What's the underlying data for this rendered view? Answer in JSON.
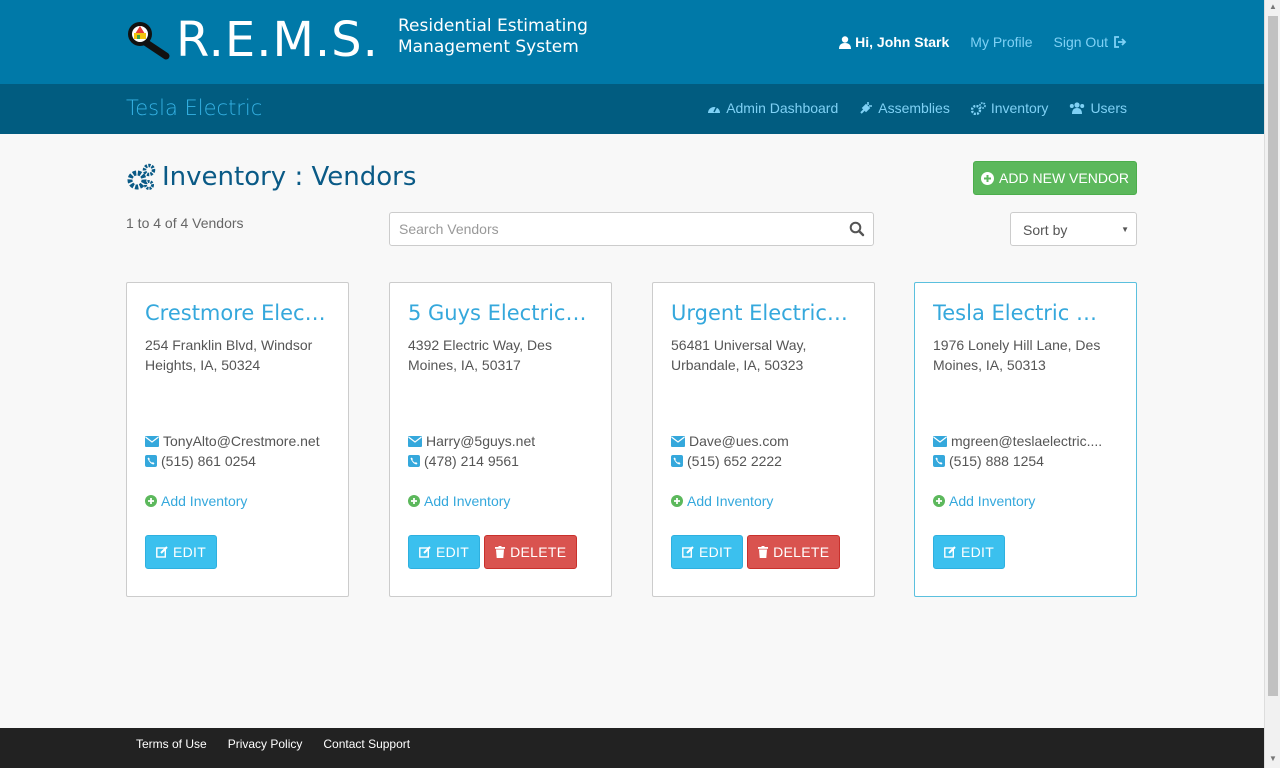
{
  "header": {
    "logo_text": "R.E.M.S.",
    "tagline_line1": "Residential Estimating",
    "tagline_line2": "Management System",
    "greeting": "Hi, John Stark",
    "my_profile": "My Profile",
    "sign_out": "Sign Out"
  },
  "subnav": {
    "company": "Tesla Electric",
    "items": [
      {
        "label": "Admin Dashboard",
        "icon": "dashboard-icon"
      },
      {
        "label": "Assemblies",
        "icon": "plug-icon"
      },
      {
        "label": "Inventory",
        "icon": "gears-icon"
      },
      {
        "label": "Users",
        "icon": "users-icon"
      }
    ]
  },
  "main": {
    "title": "Inventory : Vendors",
    "add_button": "ADD NEW VENDOR",
    "count": "1 to 4 of 4 Vendors",
    "search_placeholder": "Search Vendors",
    "sort_label": "Sort by"
  },
  "vendors": [
    {
      "name": "Crestmore Elect…",
      "address": "254 Franklin Blvd, Windsor Heights, IA, 50324",
      "email": "TonyAlto@Crestmore.net",
      "phone": "(515) 861 0254",
      "add_inventory": "Add Inventory",
      "edit": "EDIT",
      "delete": null
    },
    {
      "name": "5 Guys Electric…",
      "address": "4392 Electric Way, Des Moines, IA, 50317",
      "email": "Harry@5guys.net",
      "phone": "(478) 214 9561",
      "add_inventory": "Add Inventory",
      "edit": "EDIT",
      "delete": "DELETE"
    },
    {
      "name": "Urgent Electric…",
      "address": "56481 Universal Way, Urbandale, IA, 50323",
      "email": "Dave@ues.com",
      "phone": "(515) 652 2222",
      "add_inventory": "Add Inventory",
      "edit": "EDIT",
      "delete": "DELETE"
    },
    {
      "name": "Tesla Electric …",
      "address": "1976 Lonely Hill Lane, Des Moines, IA, 50313",
      "email": "mgreen@teslaelectric....",
      "phone": "(515) 888 1254",
      "add_inventory": "Add Inventory",
      "edit": "EDIT",
      "delete": null
    }
  ],
  "footer": {
    "terms": "Terms of Use",
    "privacy": "Privacy Policy",
    "support": "Contact Support"
  },
  "colors": {
    "header": "#0079a8",
    "subnav": "#015c80",
    "link": "#35a8dc",
    "success": "#5cb85c",
    "danger": "#d9534f",
    "info": "#3bc0ee"
  }
}
